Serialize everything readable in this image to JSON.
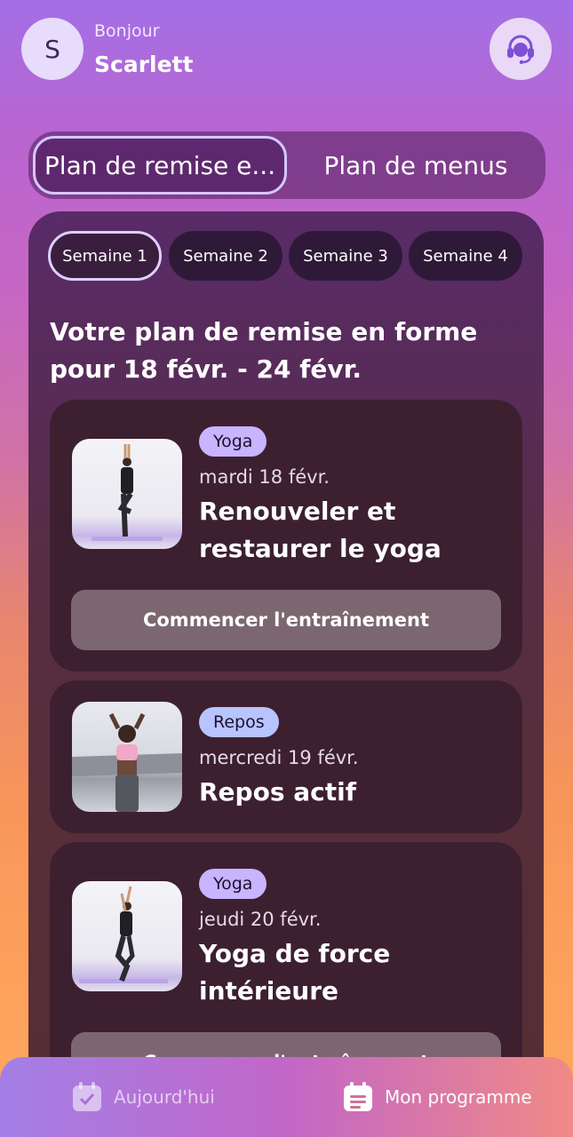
{
  "header": {
    "avatar_initial": "S",
    "greeting": "Bonjour",
    "username": "Scarlett",
    "support_icon": "headset-icon"
  },
  "segments": [
    {
      "label": "Plan de remise e...",
      "active": true
    },
    {
      "label": "Plan de menus",
      "active": false
    }
  ],
  "weeks": [
    {
      "label": "Semaine 1",
      "active": true
    },
    {
      "label": "Semaine 2",
      "active": false
    },
    {
      "label": "Semaine 3",
      "active": false
    },
    {
      "label": "Semaine 4",
      "active": false
    }
  ],
  "plan": {
    "title": "Votre plan de remise en forme pour 18 févr. - 24 févr."
  },
  "workouts": [
    {
      "badge": "Yoga",
      "date": "mardi 18 févr.",
      "title": "Renouveler et restaurer le yoga",
      "button": "Commencer l'entraînement"
    },
    {
      "badge": "Repos",
      "date": "mercredi 19 févr.",
      "title": "Repos actif"
    },
    {
      "badge": "Yoga",
      "date": "jeudi 20 févr.",
      "title": "Yoga de force intérieure",
      "button": "Commencer l'entraînement"
    }
  ],
  "tabbar": {
    "today": "Aujourd'hui",
    "program": "Mon programme"
  },
  "colors": {
    "accent_lavender": "#c8b4ff",
    "rest_badge": "#b7c4ff",
    "card_bg": "#3c2030",
    "button_bg": "#7c6770"
  }
}
